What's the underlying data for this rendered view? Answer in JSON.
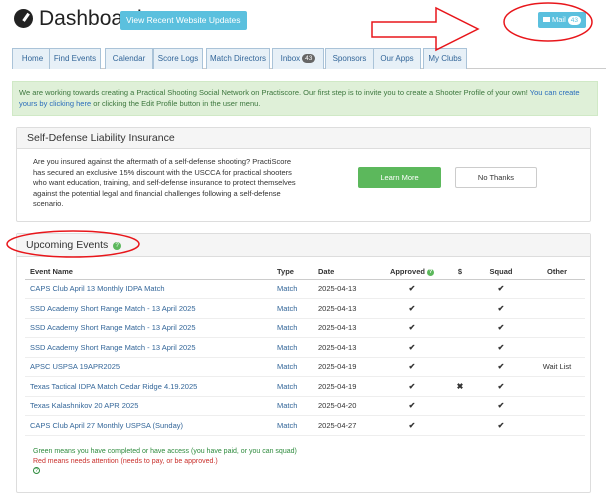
{
  "header": {
    "title": "Dashboard",
    "view_updates_label": "View Recent Website Updates",
    "mail_label": "Mail",
    "mail_count": "43"
  },
  "tabs": [
    {
      "label": "Home"
    },
    {
      "label": "Find Events"
    },
    {
      "label": "Calendar"
    },
    {
      "label": "Score Logs"
    },
    {
      "label": "Match Directors"
    },
    {
      "label": "Inbox",
      "badge": "43"
    },
    {
      "label": "Sponsors"
    },
    {
      "label": "Our Apps"
    },
    {
      "label": "My Clubs"
    }
  ],
  "alert": {
    "text1": "We are working towards creating a Practical Shooting Social Network on Practiscore. Our first step is to invite you to create a Shooter Profile of your own! ",
    "link1": "You can create yours by clicking here",
    "text2": " or clicking the Edit Profile button in the user menu."
  },
  "insurance": {
    "title": "Self-Defense Liability Insurance",
    "body": "Are you insured against the aftermath of a self-defense shooting? PractiScore has secured an exclusive 15% discount with the USCCA for practical shooters who want education, training, and self-defense insurance to protect themselves against the potential legal and financial challenges following a self-defense scenario.",
    "learn_more": "Learn More",
    "no_thanks": "No Thanks"
  },
  "events": {
    "title": "Upcoming Events",
    "columns": {
      "name": "Event Name",
      "type": "Type",
      "date": "Date",
      "approved": "Approved",
      "paid": "$",
      "squad": "Squad",
      "other": "Other"
    },
    "rows": [
      {
        "name": "CAPS Club April 13 Monthly IDPA Match",
        "type": "Match",
        "date": "2025-04-13",
        "approved": "✔",
        "paid": "",
        "squad": "✔",
        "other": ""
      },
      {
        "name": "SSD Academy Short Range Match - 13 April 2025",
        "type": "Match",
        "date": "2025-04-13",
        "approved": "✔",
        "paid": "",
        "squad": "✔",
        "other": ""
      },
      {
        "name": "SSD Academy Short Range Match - 13 April 2025",
        "type": "Match",
        "date": "2025-04-13",
        "approved": "✔",
        "paid": "",
        "squad": "✔",
        "other": ""
      },
      {
        "name": "SSD Academy Short Range Match - 13 April 2025",
        "type": "Match",
        "date": "2025-04-13",
        "approved": "✔",
        "paid": "",
        "squad": "✔",
        "other": ""
      },
      {
        "name": "APSC USPSA 19APR2025",
        "type": "Match",
        "date": "2025-04-19",
        "approved": "✔",
        "paid": "",
        "squad": "✔",
        "other": "Wait List"
      },
      {
        "name": "Texas Tactical IDPA Match Cedar Ridge 4.19.2025",
        "type": "Match",
        "date": "2025-04-19",
        "approved": "✔",
        "paid": "✖",
        "squad": "✔",
        "other": ""
      },
      {
        "name": "Texas Kalashnikov 20 APR 2025",
        "type": "Match",
        "date": "2025-04-20",
        "approved": "✔",
        "paid": "",
        "squad": "✔",
        "other": ""
      },
      {
        "name": "CAPS Club April 27 Monthly USPSA (Sunday)",
        "type": "Match",
        "date": "2025-04-27",
        "approved": "✔",
        "paid": "",
        "squad": "✔",
        "other": ""
      }
    ],
    "legend_green_word": "Green",
    "legend_green_text": " means you have completed or have access (you have paid, or you can squad)",
    "legend_red_word": "Red",
    "legend_red_text": " means needs attention (needs to pay, or be approved.)"
  },
  "annotation_color": "#e8161b"
}
